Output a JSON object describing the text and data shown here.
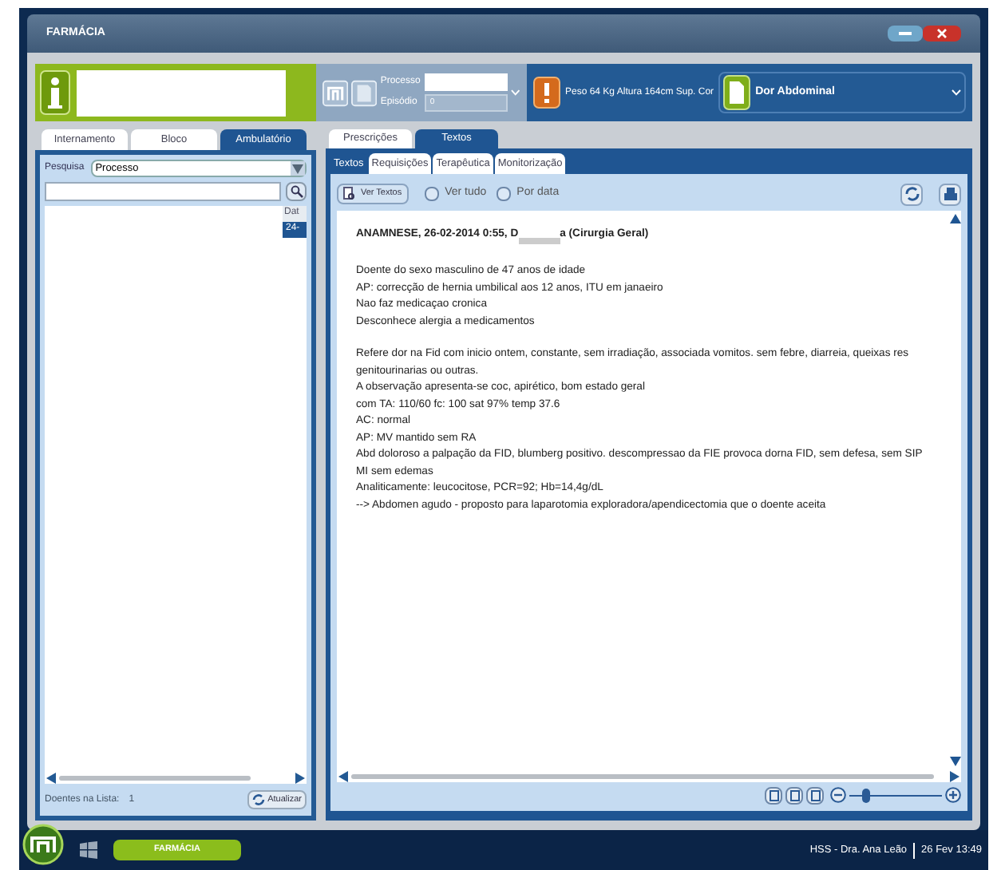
{
  "window": {
    "title": "FARMÁCIA"
  },
  "header": {
    "process_label": "Processo",
    "episode_label": "Episódio",
    "episode_value": "0",
    "vitals": "Peso 64 Kg Altura 164cm Sup. Cor",
    "diagnosis": "Dor Abdominal"
  },
  "left_tabs": [
    {
      "label": "Internamento",
      "selected": false
    },
    {
      "label": "Bloco",
      "selected": false
    },
    {
      "label": "Ambulatório",
      "selected": true
    }
  ],
  "search": {
    "label": "Pesquisa",
    "value": "Processo"
  },
  "patient_table": {
    "columns": [
      "Dat"
    ],
    "rows": [
      {
        "cells": [
          "24-"
        ],
        "selected": true
      }
    ]
  },
  "list_footer": {
    "count_label": "Doentes na Lista:",
    "count": "1",
    "refresh_button": "Atualizar"
  },
  "main_tabs": [
    {
      "label": "Prescrições",
      "selected": false
    },
    {
      "label": "Textos",
      "selected": true
    }
  ],
  "sub_tabs": [
    {
      "label": "Textos",
      "selected": true
    },
    {
      "label": "Requisições",
      "selected": false
    },
    {
      "label": "Terapêutica",
      "selected": false
    },
    {
      "label": "Monitorização",
      "selected": false
    }
  ],
  "toolbar": {
    "view_button": "Ver Textos",
    "checkboxes": [
      {
        "label": "Ver tudo",
        "checked": false
      },
      {
        "label": "Por data",
        "checked": false
      }
    ]
  },
  "document": {
    "heading_start": "ANAMNESE, 26-02-2014 0:55, D",
    "heading_end": "a (Cirurgia Geral)",
    "paragraphs": [
      [
        "Doente do sexo  masculino de 47 anos de idade",
        "AP: correcção de hernia umbilical aos 12 anos, ITU em janaeiro",
        "Nao faz medicaçao cronica",
        "Desconhece alergia a medicamentos"
      ],
      [
        "Refere dor na Fid com inicio ontem, constante, sem irradiação, associada vomitos. sem febre, diarreia, queixas res",
        "genitourinarias ou outras.",
        "A observação apresenta-se coc, apirético, bom estado geral",
        "com TA: 110/60  fc: 100 sat 97%  temp 37.6",
        "AC: normal",
        "AP: MV mantido sem RA",
        "Abd doloroso a palpação da FID, blumberg positivo. descompressao da FIE provoca dorna FID, sem defesa, sem SIP",
        "MI sem edemas",
        "Analiticamente: leucocitose, PCR=92; Hb=14,4g/dL",
        "--> Abdomen agudo - proposto para laparotomia exploradora/apendicectomia que o doente aceita"
      ]
    ]
  },
  "zoom": {
    "level": 0.15
  },
  "taskbar": {
    "app_button": "FARMÁCIA",
    "user": "HSS - Dra. Ana Leão",
    "datetime": "26 Fev 13:49"
  }
}
